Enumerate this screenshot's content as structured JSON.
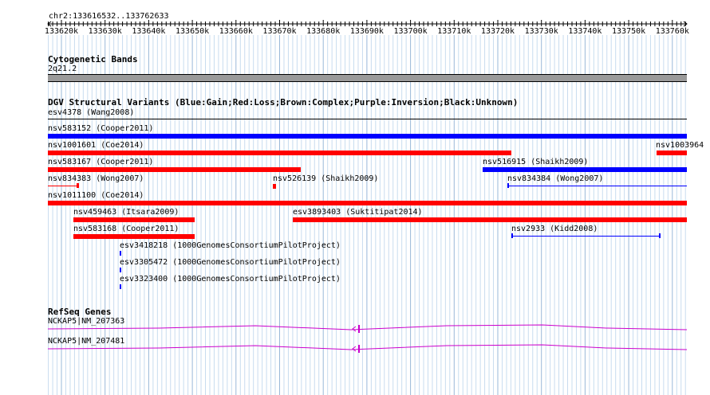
{
  "ruler": {
    "region_label": "chr2:133616532..133762633",
    "ticks": [
      "133620k",
      "133630k",
      "133640k",
      "133650k",
      "133660k",
      "133670k",
      "133680k",
      "133690k",
      "133700k",
      "133710k",
      "133720k",
      "133730k",
      "133740k",
      "133750k",
      "133760k"
    ]
  },
  "cytoband": {
    "title": "Cytogenetic Bands",
    "band_label": "2q21.2"
  },
  "dgv": {
    "title": "DGV Structural Variants (Blue:Gain;Red:Loss;Brown:Complex;Purple:Inversion;Black:Unknown)",
    "colors": {
      "gain": "#0000ff",
      "loss": "#ff0000",
      "unknown": "#000000"
    },
    "variants": [
      {
        "id": "esv4378",
        "label": "esv4378 (Wang2008)",
        "type": "unknown"
      },
      {
        "id": "nsv583152",
        "label": "nsv583152 (Cooper2011)",
        "type": "gain"
      },
      {
        "id": "nsv1001601",
        "label": "nsv1001601 (Coe2014)",
        "type": "loss"
      },
      {
        "id": "nsv1003964",
        "label": "nsv1003964",
        "type": "loss"
      },
      {
        "id": "nsv583167",
        "label": "nsv583167 (Cooper2011)",
        "type": "loss"
      },
      {
        "id": "nsv516915",
        "label": "nsv516915 (Shaikh2009)",
        "type": "gain"
      },
      {
        "id": "nsv834383",
        "label": "nsv834383 (Wong2007)",
        "type": "loss"
      },
      {
        "id": "nsv526139",
        "label": "nsv526139 (Shaikh2009)",
        "type": "loss"
      },
      {
        "id": "nsv834384",
        "label": "nsv834384 (Wong2007)",
        "type": "gain"
      },
      {
        "id": "nsv1011100",
        "label": "nsv1011100 (Coe2014)",
        "type": "loss"
      },
      {
        "id": "nsv459463",
        "label": "nsv459463 (Itsara2009)",
        "type": "loss"
      },
      {
        "id": "esv3893403",
        "label": "esv3893403 (Suktitipat2014)",
        "type": "loss"
      },
      {
        "id": "nsv583168",
        "label": "nsv583168 (Cooper2011)",
        "type": "loss"
      },
      {
        "id": "nsv2933",
        "label": "nsv2933 (Kidd2008)",
        "type": "gain"
      },
      {
        "id": "esv3418218",
        "label": "esv3418218 (1000GenomesConsortiumPilotProject)",
        "type": "gain"
      },
      {
        "id": "esv3305472",
        "label": "esv3305472 (1000GenomesConsortiumPilotProject)",
        "type": "gain"
      },
      {
        "id": "esv3323400",
        "label": "esv3323400 (1000GenomesConsortiumPilotProject)",
        "type": "gain"
      }
    ]
  },
  "refseq": {
    "title": "RefSeq Genes",
    "color": "#cc00cc",
    "genes": [
      {
        "label": "NCKAP5|NM_207363"
      },
      {
        "label": "NCKAP5|NM_207481"
      }
    ]
  }
}
